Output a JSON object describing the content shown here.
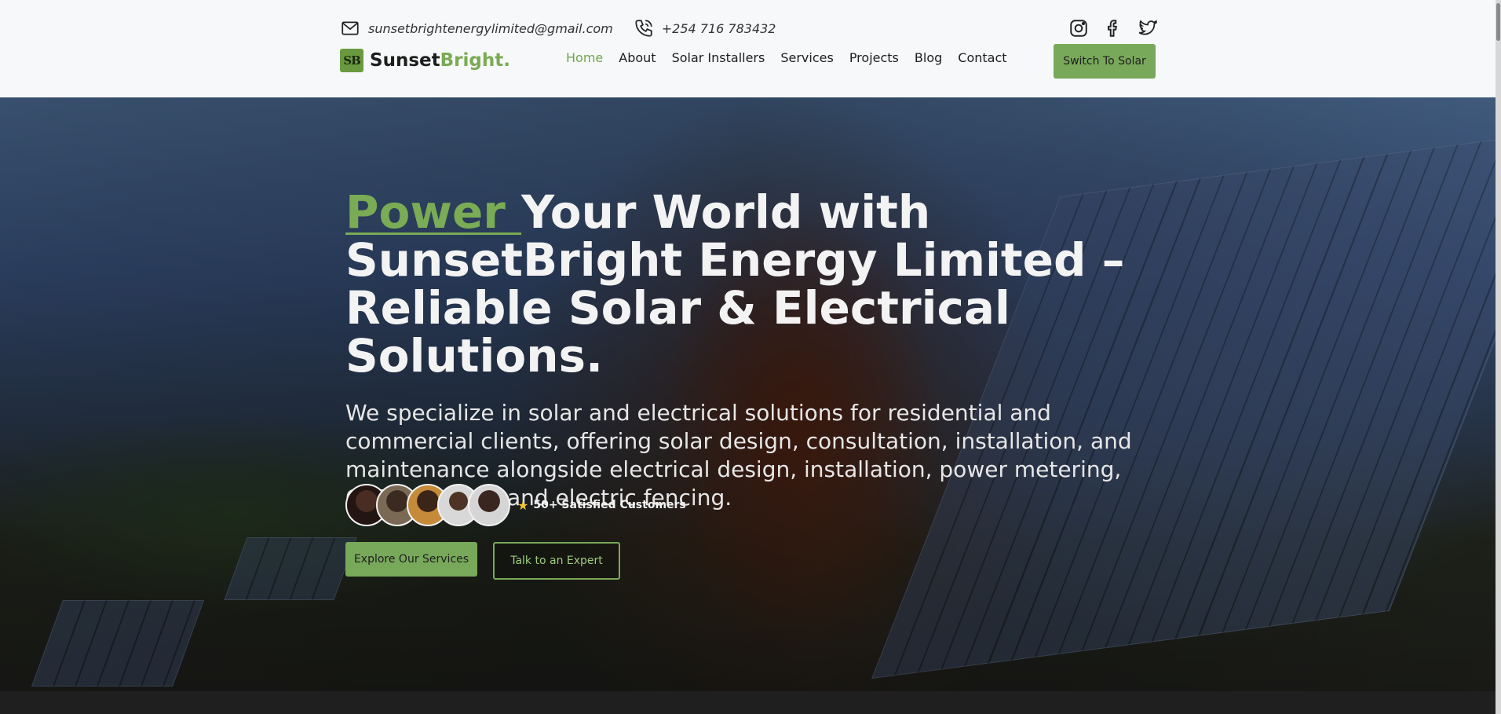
{
  "topbar": {
    "email": "sunsetbrightenergylimited@gmail.com",
    "phone": "+254 716 783432",
    "email_icon": "mail-icon",
    "phone_icon": "phone-icon",
    "socials": [
      "instagram-icon",
      "facebook-icon",
      "twitter-icon"
    ]
  },
  "logo": {
    "badge": "SB",
    "name_primary": "Sunset",
    "name_accent": "Bright",
    "name_dot": "."
  },
  "nav": {
    "items": [
      "Home",
      "About",
      "Solar Installers",
      "Services",
      "Projects",
      "Blog",
      "Contact"
    ],
    "active": "Home"
  },
  "header_cta": "Switch To Solar",
  "hero": {
    "headline_accent": "Power ",
    "headline_rest": "Your World with SunsetBright Energy Limited – Reliable Solar & Electrical Solutions.",
    "subtext": "We specialize in solar and electrical solutions for residential and commercial clients, offering solar design, consultation, installation, and maintenance alongside electrical design, installation, power metering, CCTV, alarms, and electric fencing.",
    "customers_label": "50+ Satisfied Customers",
    "primary_button": "Explore Our Services",
    "secondary_button": "Talk to an Expert"
  },
  "colors": {
    "accent": "#78a85a",
    "header_bg": "#f6f8f9",
    "text_dark": "#1e1e1e"
  }
}
